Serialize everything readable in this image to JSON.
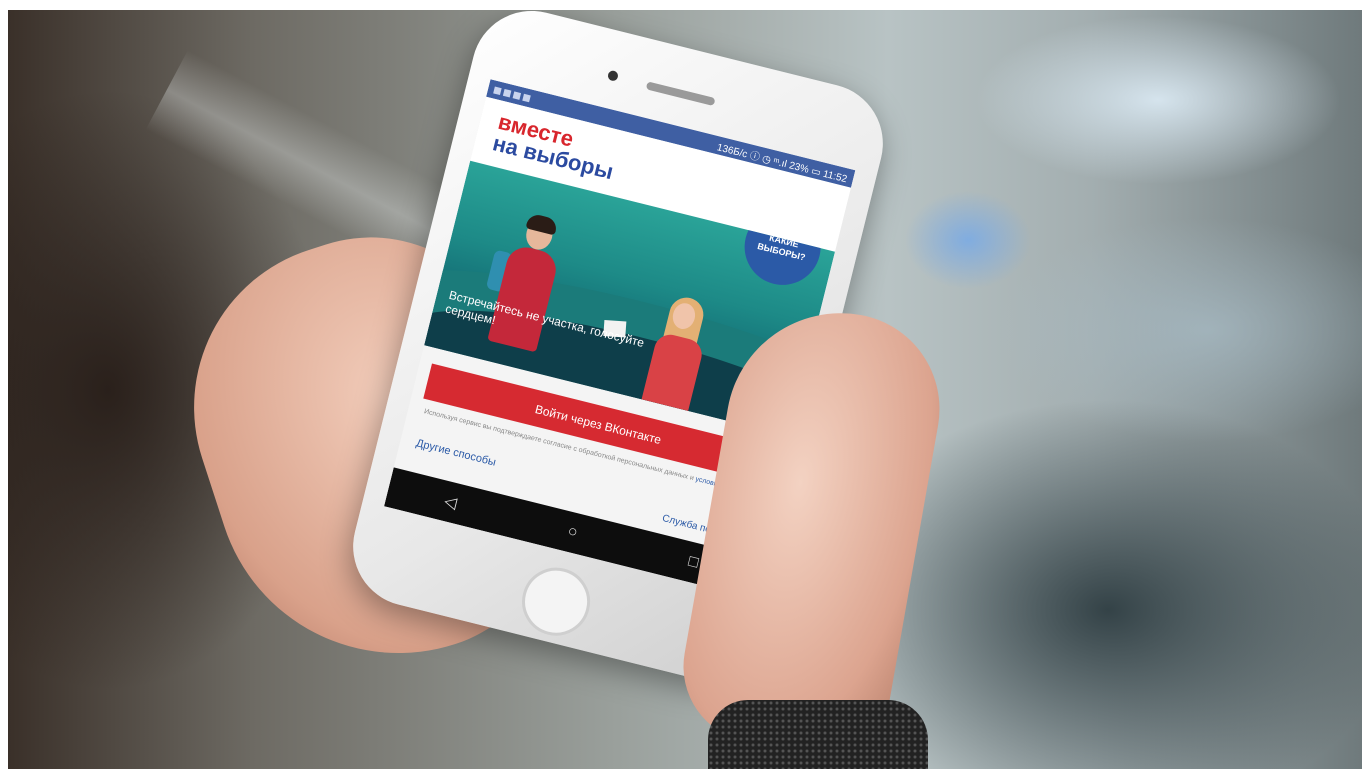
{
  "app": {
    "logo_line1": "вместе",
    "logo_line2": "на выборы",
    "badge_text": "КАКИЕ ВЫБОРЫ?",
    "hero_caption": "Встречайтесь не участка, голосуйте сердцем!",
    "vk_button_label": "Войти через ВКонтакте",
    "terms_text": "Используя сервис вы подтверждаете согласие с обработкой персональных данных и",
    "terms_link": "условиями",
    "other_ways_label": "Другие способы",
    "support_label": "Служба поддержки"
  },
  "status_bar": {
    "right": "136Б/с ⓘ ◷ ᵐ.ıl 23% ▭ 11:52"
  },
  "nav_bar": {
    "back": "◁",
    "home": "○",
    "recents": "□"
  },
  "colors": {
    "brand_red": "#d62a31",
    "brand_blue": "#2b5aa7",
    "hero_teal": "#1d8a87"
  },
  "carousel": {
    "active_page": 1,
    "total_pages": 3
  }
}
